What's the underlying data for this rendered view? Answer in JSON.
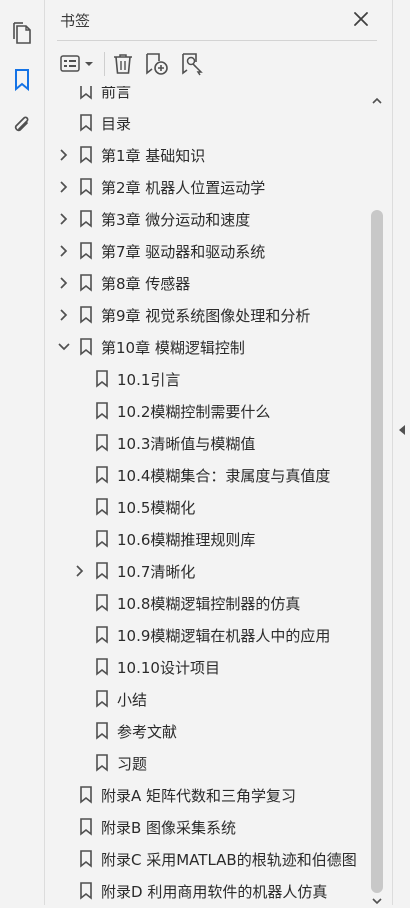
{
  "panel": {
    "title": "书签"
  },
  "icons": {
    "pages": "pages-icon",
    "bookmarks": "bookmark-icon",
    "attachments": "paperclip-icon",
    "close": "close-icon",
    "options": "options-menu-icon",
    "delete": "trash-icon",
    "new_bookmark": "add-bookmark-icon",
    "new_from_structure": "bookmark-search-icon"
  },
  "colors": {
    "accent": "#1473e6",
    "icon": "#505050",
    "background": "#f3f3f3"
  },
  "bookmarks": [
    {
      "label": "前言",
      "level": 0,
      "expander": "none"
    },
    {
      "label": "目录",
      "level": 0,
      "expander": "none"
    },
    {
      "label": "第1章  基础知识",
      "level": 0,
      "expander": "collapsed"
    },
    {
      "label": "第2章  机器人位置运动学",
      "level": 0,
      "expander": "collapsed"
    },
    {
      "label": "第3章  微分运动和速度",
      "level": 0,
      "expander": "collapsed"
    },
    {
      "label": "第7章  驱动器和驱动系统",
      "level": 0,
      "expander": "collapsed"
    },
    {
      "label": "第8章  传感器",
      "level": 0,
      "expander": "collapsed"
    },
    {
      "label": "第9章  视觉系统图像处理和分析",
      "level": 0,
      "expander": "collapsed"
    },
    {
      "label": "第10章  模糊逻辑控制",
      "level": 0,
      "expander": "expanded"
    },
    {
      "label": "10.1引言",
      "level": 1,
      "expander": "none"
    },
    {
      "label": "10.2模糊控制需要什么",
      "level": 1,
      "expander": "none"
    },
    {
      "label": "10.3清晰值与模糊值",
      "level": 1,
      "expander": "none"
    },
    {
      "label": "10.4模糊集合：隶属度与真值度",
      "level": 1,
      "expander": "none"
    },
    {
      "label": "10.5模糊化",
      "level": 1,
      "expander": "none"
    },
    {
      "label": "10.6模糊推理规则库",
      "level": 1,
      "expander": "none"
    },
    {
      "label": "10.7清晰化",
      "level": 1,
      "expander": "collapsed"
    },
    {
      "label": "10.8模糊逻辑控制器的仿真",
      "level": 1,
      "expander": "none"
    },
    {
      "label": "10.9模糊逻辑在机器人中的应用",
      "level": 1,
      "expander": "none"
    },
    {
      "label": "10.10设计项目",
      "level": 1,
      "expander": "none"
    },
    {
      "label": "小结",
      "level": 1,
      "expander": "none"
    },
    {
      "label": "参考文献",
      "level": 1,
      "expander": "none"
    },
    {
      "label": "习题",
      "level": 1,
      "expander": "none"
    },
    {
      "label": "附录A  矩阵代数和三角学复习",
      "level": 0,
      "expander": "none"
    },
    {
      "label": "附录B  图像采集系统",
      "level": 0,
      "expander": "none"
    },
    {
      "label": "附录C  采用MATLAB的根轨迹和伯德图",
      "level": 0,
      "expander": "none"
    },
    {
      "label": "附录D  利用商用软件的机器人仿真",
      "level": 0,
      "expander": "none"
    }
  ]
}
